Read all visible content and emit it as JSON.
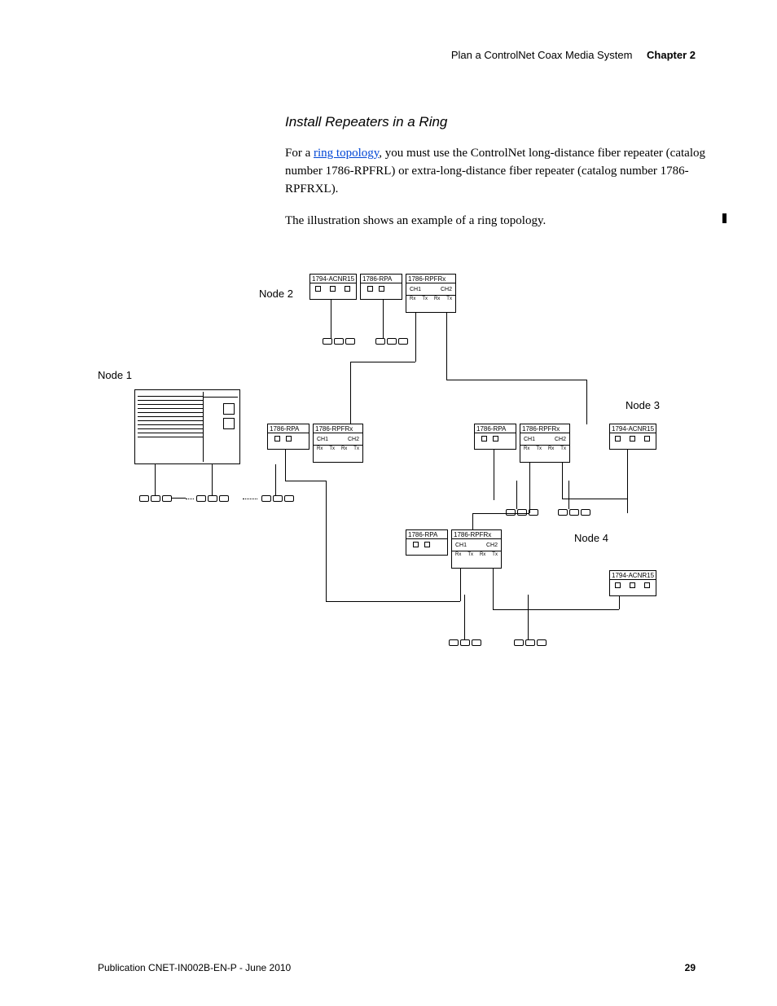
{
  "header": {
    "breadcrumb": "Plan a ControlNet Coax Media System",
    "chapter": "Chapter 2"
  },
  "section": {
    "title": "Install Repeaters in a Ring",
    "para1_pre": "For a ",
    "para1_link": "ring topology",
    "para1_post": ", you must use the ControlNet long-distance fiber repeater (catalog number 1786-RPFRL) or extra-long-distance fiber repeater (catalog number 1786-RPFRXL).",
    "para2": "The illustration shows an example of a ring topology."
  },
  "diagram": {
    "nodes": {
      "n1": "Node 1",
      "n2": "Node 2",
      "n3": "Node 3",
      "n4": "Node 4"
    },
    "modules": {
      "acnr": "1794-ACNR15",
      "rpa": "1786-RPA",
      "rpfrx": "1786-RPFRx"
    },
    "ports": {
      "ch1": "CH1",
      "ch2": "CH2",
      "rx": "Rx",
      "tx": "Tx"
    }
  },
  "footer": {
    "pub": "Publication CNET-IN002B-EN-P - June 2010",
    "page": "29"
  }
}
